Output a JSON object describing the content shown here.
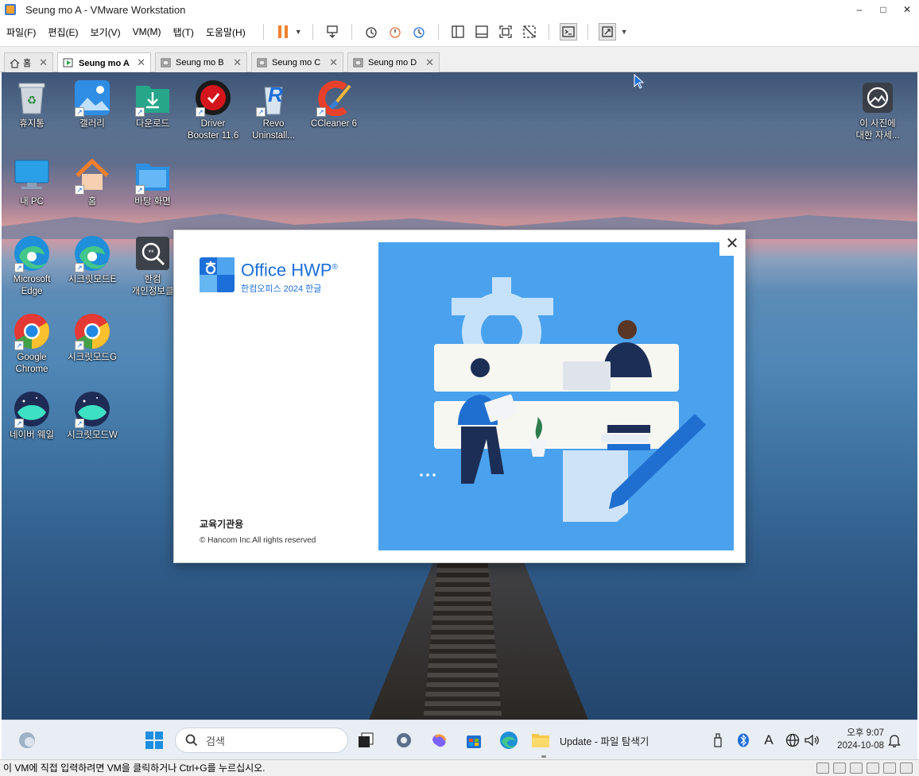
{
  "window": {
    "title": "Seung mo A - VMware Workstation",
    "minimize": "–",
    "maximize": "□",
    "close": "✕"
  },
  "menu": [
    "파일(F)",
    "편집(E)",
    "보기(V)",
    "VM(M)",
    "탭(T)",
    "도움말(H)"
  ],
  "tabs": [
    {
      "label": "홈",
      "active": false
    },
    {
      "label": "Seung mo A",
      "active": true
    },
    {
      "label": "Seung mo B",
      "active": false
    },
    {
      "label": "Seung mo C",
      "active": false
    },
    {
      "label": "Seung mo D",
      "active": false
    }
  ],
  "desktop_icons": [
    {
      "label": "휴지통"
    },
    {
      "label": "갤러리"
    },
    {
      "label": "다운로드"
    },
    {
      "label": "Driver\nBooster 11.6"
    },
    {
      "label": "Revo\nUninstall..."
    },
    {
      "label": "CCleaner 6"
    },
    {
      "label": "이 사진에\n대한 자세..."
    },
    {
      "label": "내 PC"
    },
    {
      "label": "홈"
    },
    {
      "label": "바탕 화면"
    },
    {
      "label": "Microsoft\nEdge"
    },
    {
      "label": "시크릿모드E"
    },
    {
      "label": "한컴\n개인정보클"
    },
    {
      "label": "Google\nChrome"
    },
    {
      "label": "시크릿모드G"
    },
    {
      "label": "네이버 웨일"
    },
    {
      "label": "시크릿모드W"
    }
  ],
  "splash": {
    "product_name_office": "Office",
    "product_name_hwp": "HWP",
    "registered": "®",
    "subtitle": "한컴오피스 2024 한글",
    "license": "교육기관용",
    "copyright": "© Hancom Inc.All rights reserved",
    "close": "✕"
  },
  "taskbar": {
    "search_placeholder": "검색",
    "explorer_label": "Update - 파일 탐색기",
    "time": "오후 9:07",
    "date": "2024-10-08",
    "ime": "A"
  },
  "status": {
    "message": "이 VM에 직접 입력하려면 VM을 클릭하거나 Ctrl+G를 누르십시오."
  },
  "colors": {
    "accent": "#1c6fd8",
    "splash_art_bg": "#4aa2ee",
    "pause": "#f07f2f"
  }
}
